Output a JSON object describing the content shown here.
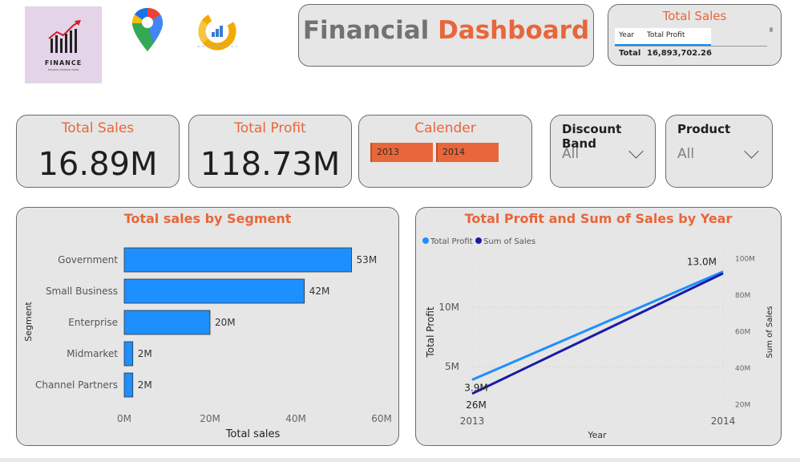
{
  "logos": {
    "finance_logo_text": "FINANCE",
    "finance_logo_subtext": "FINANCE COMPANY NAME"
  },
  "header": {
    "title_part1": "Financial",
    "title_part2": "Dashboard"
  },
  "mini_table": {
    "title": "Total Sales",
    "columns": [
      "Year",
      "Total Profit"
    ],
    "total_label": "Total",
    "total_value": "16,893,702.26"
  },
  "kpis": {
    "total_sales": {
      "label": "Total Sales",
      "value": "16.89M"
    },
    "total_profit": {
      "label": "Total Profit",
      "value": "118.73M"
    }
  },
  "calendar": {
    "label": "Calender",
    "years": [
      "2013",
      "2014"
    ]
  },
  "slicers": {
    "discount_band": {
      "label": "Discount Band",
      "value": "All"
    },
    "product": {
      "label": "Product",
      "value": "All"
    }
  },
  "colors": {
    "accent": "#e8663a",
    "bar": "#1e8fff",
    "line_profit": "#1e8fff",
    "line_sales": "#1a1aa6",
    "card_bg": "#e6e6e6"
  },
  "chart_data": [
    {
      "type": "bar",
      "orientation": "horizontal",
      "title": "Total sales by Segment",
      "xlabel": "Total sales",
      "ylabel": "Segment",
      "categories": [
        "Government",
        "Small Business",
        "Enterprise",
        "Midmarket",
        "Channel Partners"
      ],
      "values": [
        53,
        42,
        20,
        2,
        2
      ],
      "value_labels": [
        "53M",
        "42M",
        "20M",
        "2M",
        "2M"
      ],
      "xlim": [
        0,
        60
      ],
      "xticks": [
        "0M",
        "20M",
        "40M",
        "60M"
      ],
      "xtick_values": [
        0,
        20,
        40,
        60
      ]
    },
    {
      "type": "line",
      "title": "Total Profit and Sum of Sales by Year",
      "xlabel": "Year",
      "ylabel": "Total Profit",
      "y2label": "Sum of Sales",
      "legend": "top-left",
      "x": [
        "2013",
        "2014"
      ],
      "series": [
        {
          "name": "Total Profit",
          "axis": "left",
          "values": [
            3.9,
            13.0
          ],
          "labels": [
            "3.9M",
            "13.0M"
          ]
        },
        {
          "name": "Sum of Sales",
          "axis": "right",
          "values": [
            26,
            92
          ],
          "labels": [
            "26M",
            ""
          ]
        }
      ],
      "ylim": [
        1.5,
        15
      ],
      "yticks": [
        "5M",
        "10M"
      ],
      "ytick_values": [
        5,
        10
      ],
      "y2lim": [
        18,
        106
      ],
      "y2ticks": [
        "20M",
        "40M",
        "60M",
        "80M",
        "100M"
      ],
      "y2tick_values": [
        20,
        40,
        60,
        80,
        100
      ]
    }
  ]
}
